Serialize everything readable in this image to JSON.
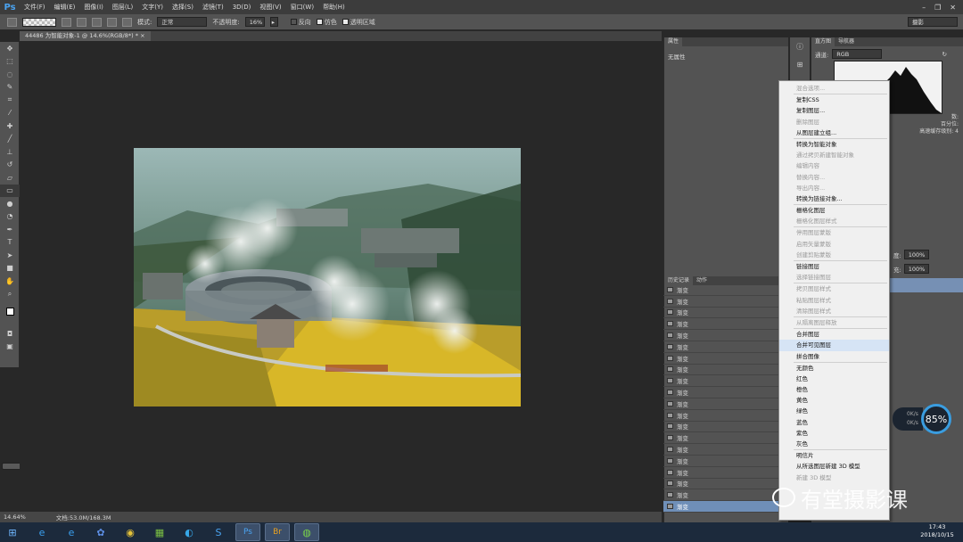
{
  "app_logo": "Ps",
  "menu": [
    "文件(F)",
    "编辑(E)",
    "图像(I)",
    "图层(L)",
    "文字(Y)",
    "选择(S)",
    "滤镜(T)",
    "3D(D)",
    "视图(V)",
    "窗口(W)",
    "帮助(H)"
  ],
  "window_controls": [
    "–",
    "❐",
    "✕"
  ],
  "options": {
    "mode_label": "模式:",
    "mode_value": "正常",
    "opacity_label": "不透明度:",
    "opacity_value": "16%",
    "reverse_label": "反向",
    "dither_label": "仿色",
    "transparency_label": "透明区域",
    "workspace": "摄影"
  },
  "document": {
    "tab_title": "44486 为智能对象-1 @ 14.6%(RGB/8*) *",
    "tab_close": "×"
  },
  "status": {
    "zoom": "14.64%",
    "doc_info": "文档:53.0M/168.3M"
  },
  "dock1": {
    "properties_tab": "属性",
    "properties_empty": "无属性",
    "history_tab": "历史记录",
    "actions_tab": "动作",
    "history_item": "渐变"
  },
  "dock2": {
    "histogram_tab": "直方图",
    "navigator_tab": "导航器",
    "channel_label": "通道:",
    "channel_value": "RGB",
    "stats": [
      "数:",
      "百分位:",
      "高速缓存级别: 4"
    ],
    "layer_opacity_label": "度:",
    "layer_opacity_value": "100%",
    "layer_fill_label": "充:",
    "layer_fill_value": "100%"
  },
  "context_menu": {
    "items": [
      {
        "label": "混合选项...",
        "enabled": false
      },
      {
        "sep": true
      },
      {
        "label": "复制CSS",
        "enabled": true
      },
      {
        "label": "复制图层...",
        "enabled": true
      },
      {
        "label": "删除图层",
        "enabled": false
      },
      {
        "label": "从图层建立组...",
        "enabled": true
      },
      {
        "sep": true
      },
      {
        "label": "转换为智能对象",
        "enabled": true
      },
      {
        "label": "通过拷贝新建智能对象",
        "enabled": false
      },
      {
        "label": "编辑内容",
        "enabled": false
      },
      {
        "label": "替换内容...",
        "enabled": false
      },
      {
        "label": "导出内容...",
        "enabled": false
      },
      {
        "label": "转换为链接对象...",
        "enabled": true
      },
      {
        "sep": true
      },
      {
        "label": "栅格化图层",
        "enabled": true
      },
      {
        "label": "栅格化图层样式",
        "enabled": false
      },
      {
        "sep": true
      },
      {
        "label": "停用图层蒙版",
        "enabled": false
      },
      {
        "label": "启用矢量蒙版",
        "enabled": false
      },
      {
        "label": "创建剪贴蒙版",
        "enabled": false
      },
      {
        "sep": true
      },
      {
        "label": "链接图层",
        "enabled": true
      },
      {
        "label": "选择链接图层",
        "enabled": false
      },
      {
        "sep": true
      },
      {
        "label": "拷贝图层样式",
        "enabled": false
      },
      {
        "label": "粘贴图层样式",
        "enabled": false
      },
      {
        "label": "清除图层样式",
        "enabled": false
      },
      {
        "sep": true
      },
      {
        "label": "从隔离图层释放",
        "enabled": false
      },
      {
        "sep": true
      },
      {
        "label": "合并图层",
        "enabled": true
      },
      {
        "label": "合并可见图层",
        "enabled": true,
        "highlight": true
      },
      {
        "label": "拼合图像",
        "enabled": true
      },
      {
        "sep": true
      },
      {
        "label": "无颜色",
        "enabled": true
      },
      {
        "label": "红色",
        "enabled": true
      },
      {
        "label": "橙色",
        "enabled": true
      },
      {
        "label": "黄色",
        "enabled": true
      },
      {
        "label": "绿色",
        "enabled": true
      },
      {
        "label": "蓝色",
        "enabled": true
      },
      {
        "label": "紫色",
        "enabled": true
      },
      {
        "label": "灰色",
        "enabled": true
      },
      {
        "sep": true
      },
      {
        "label": "明信片",
        "enabled": true
      },
      {
        "label": "从所选图层新建 3D 模型",
        "enabled": true
      },
      {
        "label": "新建 3D 模型",
        "enabled": false
      }
    ]
  },
  "widget": {
    "cpu": "85%",
    "up": "0K/s",
    "down": "0K/s"
  },
  "watermark": "有堂摄影课",
  "taskbar": {
    "time": "17:43",
    "date": "2018/10/15"
  }
}
